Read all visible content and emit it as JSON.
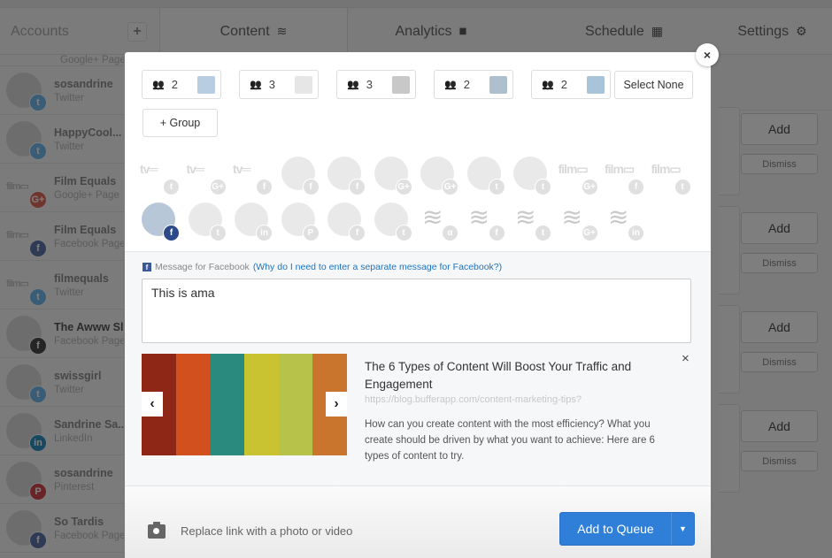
{
  "nav": {
    "accounts_label": "Accounts",
    "add_account": "+",
    "tabs": [
      {
        "label": "Content",
        "icon": "≋",
        "icon_name": "layers-icon",
        "active": true
      },
      {
        "label": "Analytics",
        "icon": "▮▮",
        "icon_name": "bar-chart-icon"
      },
      {
        "label": "Schedule",
        "icon": "▦",
        "icon_name": "calendar-icon"
      },
      {
        "label": "Settings",
        "icon": "⚙",
        "icon_name": "gear-icon"
      }
    ]
  },
  "sidebar": {
    "partial_top": {
      "type": "Google+ Page"
    },
    "accounts": [
      {
        "name": "sosandrine",
        "type": "Twitter",
        "badge": "t",
        "color": "#55acee"
      },
      {
        "name": "HappyCool...",
        "type": "Twitter",
        "badge": "t",
        "color": "#55acee"
      },
      {
        "name": "Film Equals",
        "type": "Google+ Page",
        "badge": "G+",
        "color": "#dd4b39",
        "logo": "film"
      },
      {
        "name": "Film Equals",
        "type": "Facebook Page",
        "badge": "f",
        "color": "#3b5998",
        "logo": "film"
      },
      {
        "name": "filmequals",
        "type": "Twitter",
        "badge": "t",
        "color": "#55acee",
        "logo": "film"
      },
      {
        "name": "The Awww Sl",
        "type": "Facebook Page",
        "badge": "f",
        "color": "#222",
        "active": true
      },
      {
        "name": "swissgirl",
        "type": "Twitter",
        "badge": "t",
        "color": "#55acee"
      },
      {
        "name": "Sandrine Sa...",
        "type": "LinkedIn",
        "badge": "in",
        "color": "#0077b5"
      },
      {
        "name": "sosandrine",
        "type": "Pinterest",
        "badge": "P",
        "color": "#cb2027"
      },
      {
        "name": "So Tardis",
        "type": "Facebook Page",
        "badge": "f",
        "color": "#3b5998"
      }
    ]
  },
  "suggestions": {
    "add_label": "Add",
    "dismiss_label": "Dismiss",
    "count": 4
  },
  "modal": {
    "close": "×",
    "groups": [
      {
        "count": "2"
      },
      {
        "count": "3"
      },
      {
        "count": "3"
      },
      {
        "count": "2"
      },
      {
        "count": "2"
      }
    ],
    "select_none": "Select None",
    "add_group": "+ Group",
    "profiles_row1": [
      {
        "logo": "tv",
        "net": "twitter",
        "badge": "t"
      },
      {
        "logo": "tv",
        "net": "google-plus",
        "badge": "G+"
      },
      {
        "logo": "tv",
        "net": "facebook",
        "badge": "f"
      },
      {
        "net": "facebook",
        "badge": "f"
      },
      {
        "net": "facebook",
        "badge": "f"
      },
      {
        "net": "google-plus",
        "badge": "G+"
      },
      {
        "net": "google-plus",
        "badge": "G+"
      },
      {
        "net": "twitter",
        "badge": "t"
      },
      {
        "net": "twitter",
        "badge": "t"
      },
      {
        "logo": "film",
        "net": "google-plus",
        "badge": "G+"
      },
      {
        "logo": "film",
        "net": "facebook",
        "badge": "f"
      },
      {
        "logo": "film",
        "net": "twitter",
        "badge": "t"
      }
    ],
    "profiles_row2": [
      {
        "net": "facebook",
        "badge": "f",
        "selected": true
      },
      {
        "net": "twitter",
        "badge": "t"
      },
      {
        "net": "linkedin",
        "badge": "in"
      },
      {
        "net": "pinterest",
        "badge": "P"
      },
      {
        "net": "facebook",
        "badge": "f"
      },
      {
        "net": "twitter",
        "badge": "t"
      },
      {
        "logo": "stack",
        "net": "app",
        "badge": "α"
      },
      {
        "logo": "stack",
        "net": "facebook",
        "badge": "f"
      },
      {
        "logo": "stack",
        "net": "twitter",
        "badge": "t"
      },
      {
        "logo": "stack",
        "net": "google-plus",
        "badge": "G+"
      },
      {
        "logo": "stack",
        "net": "linkedin",
        "badge": "in"
      }
    ],
    "message_label": "Message for Facebook",
    "message_help_link": "(Why do I need to enter a separate message for Facebook?)",
    "message_value": "This is ama",
    "preview": {
      "title": "The 6 Types of Content Will Boost Your Traffic and Engagement",
      "url": "https://blog.bufferapp.com/content-marketing-tips?",
      "description": "How can you create content with the most efficiency? What you create should be driven by what you want to achieve: Here are 6 types of content to try.",
      "prev": "‹",
      "next": "›",
      "close": "×",
      "image_colors": [
        "#8f2716",
        "#d2501e",
        "#2a8a7e",
        "#c9c331",
        "#b7c24a",
        "#c9752e"
      ]
    },
    "replace_link": "Replace link with a photo or video",
    "queue_button": "Add to Queue",
    "queue_caret": "▼"
  },
  "colors": {
    "accent": "#2f7fd8",
    "facebook": "#3b5998",
    "link": "#1e73be"
  }
}
